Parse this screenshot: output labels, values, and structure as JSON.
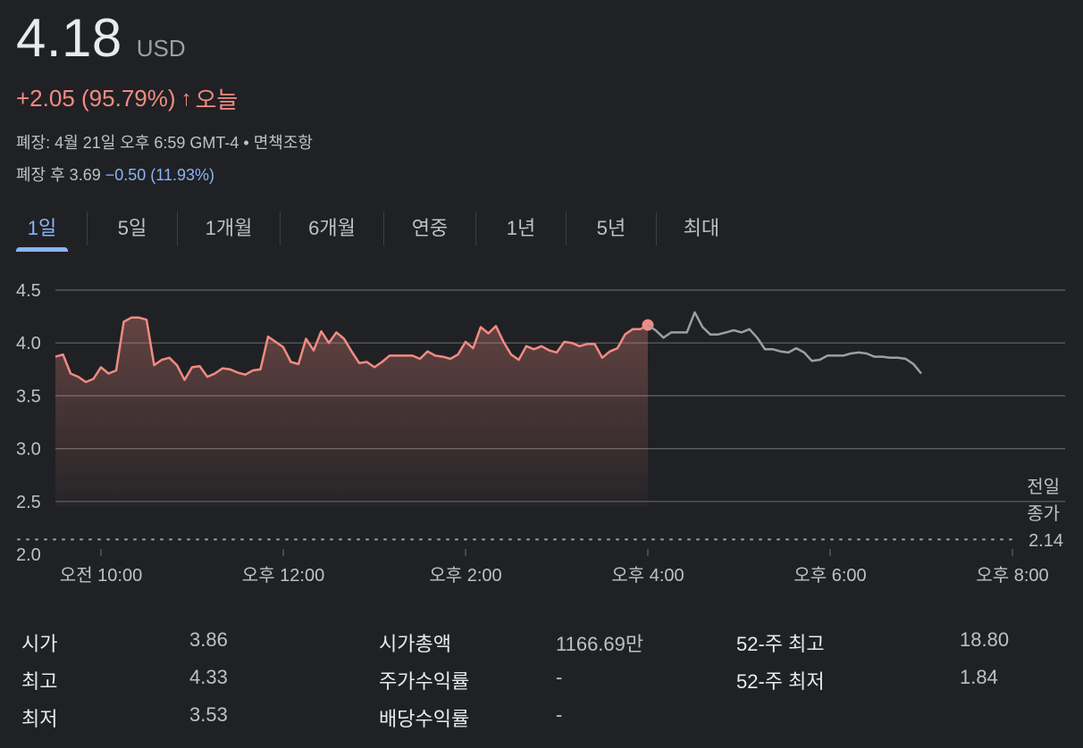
{
  "quote": {
    "price": "4.18",
    "currency": "USD",
    "change": "+2.05 (95.79%)",
    "arrow": "↑",
    "period": "오늘",
    "closed_info": "폐장: 4월 21일 오후 6:59 GMT-4 • 면책조항",
    "after_hours_label": "폐장 후 3.69",
    "after_hours_change": "−0.50 (11.93%)"
  },
  "tabs": [
    {
      "label": "1일",
      "active": true
    },
    {
      "label": "5일"
    },
    {
      "label": "1개월"
    },
    {
      "label": "6개월"
    },
    {
      "label": "연중"
    },
    {
      "label": "1년"
    },
    {
      "label": "5년"
    },
    {
      "label": "최대"
    }
  ],
  "chart_data": {
    "type": "line",
    "ylim": [
      2.0,
      4.5
    ],
    "y_ticks": [
      "4.5",
      "4.0",
      "3.5",
      "3.0",
      "2.5",
      "2.0"
    ],
    "x_ticks": [
      "오전 10:00",
      "오후 12:00",
      "오후 2:00",
      "오후 4:00",
      "오후 6:00",
      "오후 8:00"
    ],
    "x_tick_hours": [
      10,
      12,
      14,
      16,
      18,
      20
    ],
    "x_range_hours": [
      9.5,
      20.0
    ],
    "previous_close": 2.14,
    "previous_close_label_line1": "전일",
    "previous_close_label_line2": "종가",
    "previous_close_value": "2.14",
    "colors": {
      "regular": "#f28b82",
      "after_hours": "#9aa0a6",
      "grid": "#5f6368",
      "axis_text": "#bdc1c6"
    },
    "series": [
      {
        "segment": "regular",
        "hour_start": 9.5,
        "hour_end": 16.0,
        "values": [
          3.87,
          3.89,
          3.71,
          3.68,
          3.63,
          3.66,
          3.77,
          3.71,
          3.74,
          4.2,
          4.24,
          4.24,
          4.22,
          3.79,
          3.84,
          3.86,
          3.79,
          3.65,
          3.77,
          3.78,
          3.68,
          3.71,
          3.76,
          3.75,
          3.72,
          3.7,
          3.74,
          3.75,
          4.06,
          4.01,
          3.96,
          3.82,
          3.8,
          4.04,
          3.93,
          4.11,
          4.0,
          4.1,
          4.04,
          3.92,
          3.81,
          3.82,
          3.77,
          3.82,
          3.88,
          3.88,
          3.88,
          3.88,
          3.85,
          3.92,
          3.88,
          3.87,
          3.85,
          3.89,
          4.01,
          3.95,
          4.15,
          4.09,
          4.16,
          4.01,
          3.89,
          3.84,
          3.97,
          3.94,
          3.97,
          3.93,
          3.91,
          4.01,
          4.0,
          3.97,
          3.99,
          3.99,
          3.86,
          3.92,
          3.95,
          4.08,
          4.13,
          4.13,
          4.17
        ]
      },
      {
        "segment": "after_hours",
        "hour_start": 16.0,
        "hour_end": 19.0,
        "values": [
          4.17,
          4.12,
          4.05,
          4.1,
          4.1,
          4.1,
          4.29,
          4.15,
          4.08,
          4.08,
          4.1,
          4.12,
          4.1,
          4.13,
          4.05,
          3.94,
          3.94,
          3.92,
          3.91,
          3.95,
          3.91,
          3.83,
          3.84,
          3.88,
          3.88,
          3.88,
          3.9,
          3.91,
          3.9,
          3.87,
          3.87,
          3.86,
          3.86,
          3.85,
          3.8,
          3.71
        ]
      }
    ],
    "last_price": 4.17
  },
  "stats": [
    {
      "label": "시가",
      "value": "3.86"
    },
    {
      "label": "최고",
      "value": "4.33"
    },
    {
      "label": "최저",
      "value": "3.53"
    },
    {
      "label": "시가총액",
      "value": "1166.69만"
    },
    {
      "label": "주가수익률",
      "value": "-"
    },
    {
      "label": "배당수익률",
      "value": "-"
    },
    {
      "label": "52-주 최고",
      "value": "18.80"
    },
    {
      "label": "52-주 최저",
      "value": "1.84"
    }
  ]
}
